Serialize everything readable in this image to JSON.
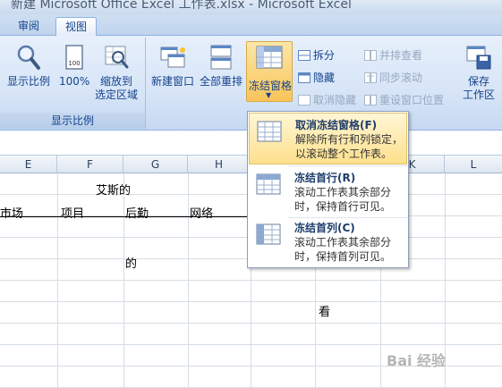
{
  "window": {
    "title": "新建 Microsoft Office Excel 工作表.xlsx - Microsoft Excel"
  },
  "tabs": [
    {
      "label": "审阅"
    },
    {
      "label": "视图"
    }
  ],
  "ribbon": {
    "zoom_group": {
      "label": "显示比例",
      "buttons": [
        {
          "label": "显示比例",
          "icon": "magnifier-icon"
        },
        {
          "label": "100%",
          "icon": "page-100-icon"
        },
        {
          "label_line1": "缩放到",
          "label_line2": "选定区域",
          "icon": "zoom-selection-icon"
        }
      ]
    },
    "window_group": {
      "new_window": "新建窗口",
      "arrange_all": "全部重排",
      "freeze_panes": "冻结窗格",
      "split": "拆分",
      "hide": "隐藏",
      "unhide": "取消隐藏",
      "side_by_side": "并排查看",
      "sync_scroll": "同步滚动",
      "reset_position": "重设窗口位置",
      "save_line1": "保存",
      "save_line2": "工作区"
    }
  },
  "sheet": {
    "columns": [
      "E",
      "F",
      "G",
      "H",
      "K",
      "L"
    ],
    "cells": {
      "title": "艾斯的",
      "market": "市场",
      "project": "项目",
      "logistics": "后勤",
      "network": "网络",
      "de": "的",
      "kan": "看"
    }
  },
  "freeze_menu": {
    "items": [
      {
        "title": "取消冻结窗格(F)",
        "desc_line1": "解除所有行和列锁定，",
        "desc_line2": "以滚动整个工作表。"
      },
      {
        "title": "冻结首行(R)",
        "desc_line1": "滚动工作表其余部分",
        "desc_line2": "时，保持首行可见。"
      },
      {
        "title": "冻结首列(C)",
        "desc_line1": "滚动工作表其余部分",
        "desc_line2": "时，保持首列可见。"
      }
    ]
  },
  "watermark": "Bai 经验"
}
